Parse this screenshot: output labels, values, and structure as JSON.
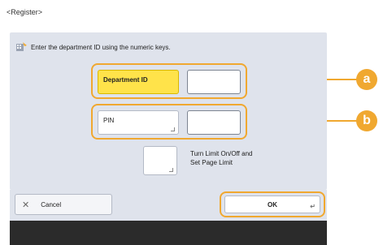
{
  "screen": {
    "caption": "<Register>",
    "instruction": "Enter the department ID using the numeric keys."
  },
  "fields": {
    "department_id": {
      "label": "Department ID",
      "value": "",
      "callout": "a"
    },
    "pin": {
      "label": "PIN",
      "value": "",
      "callout": "b"
    }
  },
  "limit": {
    "label_line1": "Turn Limit On/Off and",
    "label_line2": "Set Page Limit"
  },
  "actions": {
    "cancel_label": "Cancel",
    "ok_label": "OK"
  },
  "colors": {
    "accent": "#f0a830",
    "selected": "#ffe34a",
    "panel": "#dfe3ec"
  }
}
